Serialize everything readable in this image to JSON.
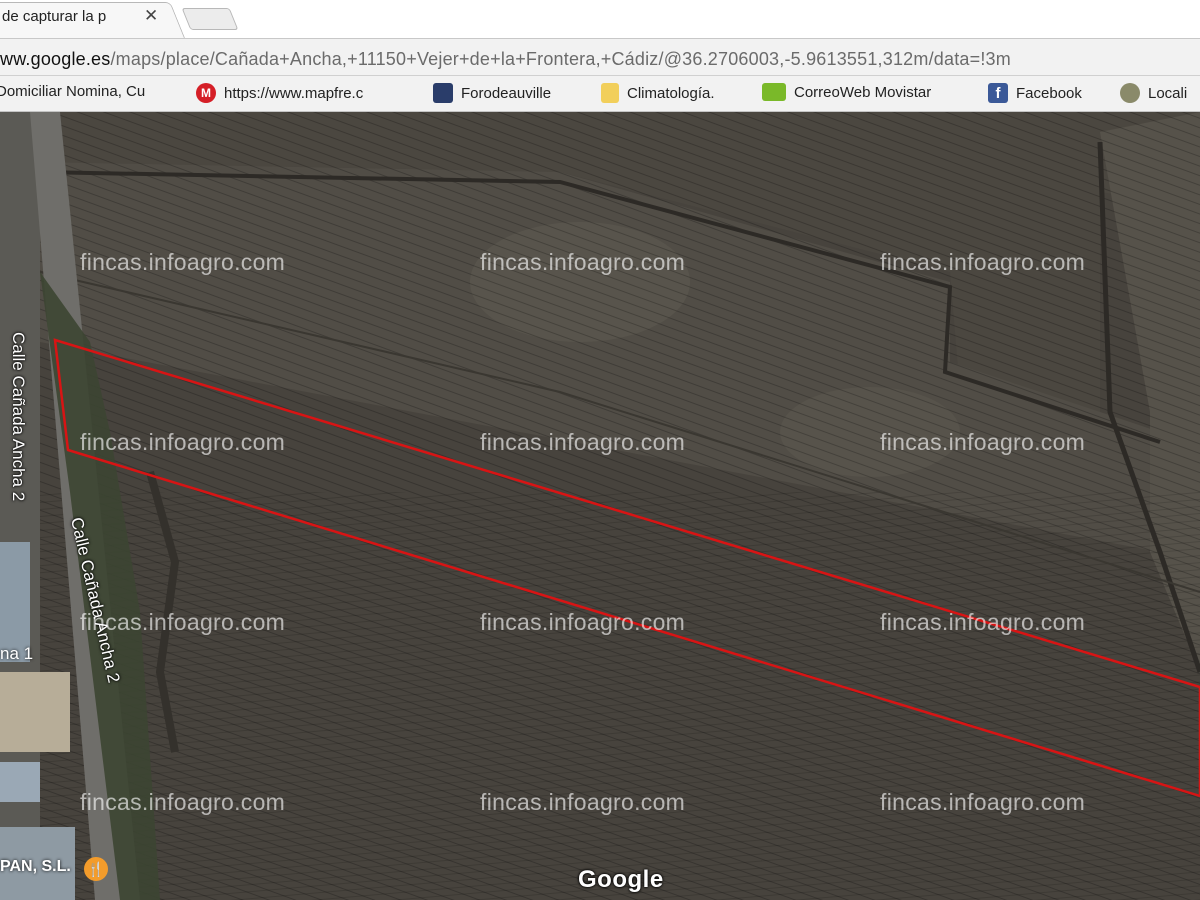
{
  "browser": {
    "tab_title": "de capturar la p",
    "close_glyph": "✕",
    "url_host": "ww.google.es",
    "url_path": "/maps/place/Cañada+Ancha,+11150+Vejer+de+la+Frontera,+Cádiz/@36.2706003,-5.9613551,312m/data=!3m"
  },
  "bookmarks": [
    {
      "label": "Domiciliar Nomina, Cu",
      "icon": "document-icon",
      "color": "#cccccc"
    },
    {
      "label": "https://www.mapfre.c",
      "icon": "mapfre-icon",
      "color": "#d51f27"
    },
    {
      "label": "Forodeauville",
      "icon": "forum-icon",
      "color": "#2a3d6a"
    },
    {
      "label": "Climatología.",
      "icon": "folder-icon",
      "color": "#f2cf5b"
    },
    {
      "label": "CorreoWeb Movistar",
      "icon": "movistar-icon",
      "color": "#7ab929"
    },
    {
      "label": "Facebook",
      "icon": "facebook-icon",
      "color": "#3b5998"
    },
    {
      "label": "Locali",
      "icon": "globe-icon",
      "color": "#8a8a6a"
    }
  ],
  "map": {
    "watermark": "fincas.infoagro.com",
    "attribution": "Google",
    "streets": [
      "Calle Cañada Ancha 2",
      "Calle Cañada Ancha 2"
    ],
    "street_fragment": "na 1",
    "business": "PAN, S.L.",
    "business_icon": "restaurant-icon",
    "parcel_outline_color": "#d81414"
  }
}
